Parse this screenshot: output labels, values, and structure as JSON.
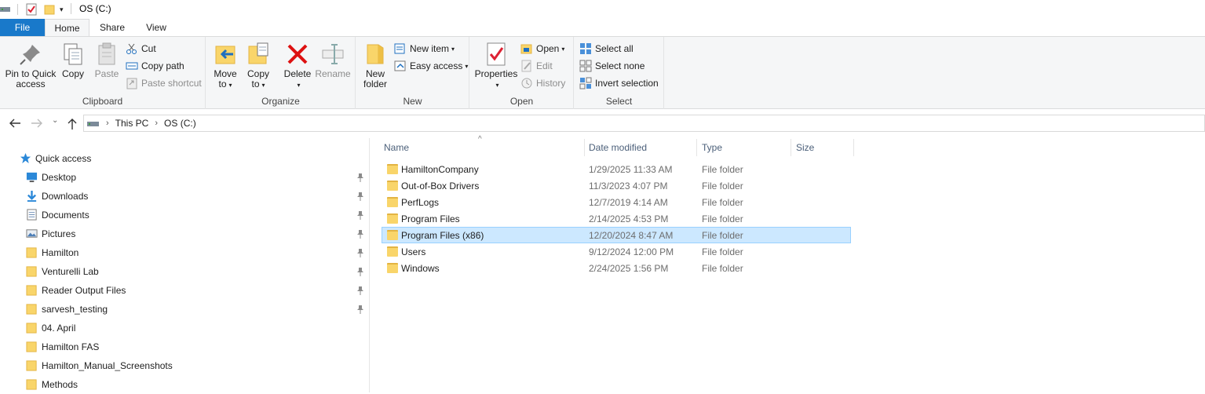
{
  "window": {
    "title": "OS (C:)"
  },
  "tabs": [
    "File",
    "Home",
    "Share",
    "View"
  ],
  "ribbon": {
    "clipboard": {
      "label": "Clipboard",
      "pin_label_1": "Pin to Quick",
      "pin_label_2": "access",
      "copy": "Copy",
      "paste": "Paste",
      "cut": "Cut",
      "copy_path": "Copy path",
      "paste_shortcut": "Paste shortcut"
    },
    "organize": {
      "label": "Organize",
      "move_1": "Move",
      "move_2": "to",
      "copy_1": "Copy",
      "copy_2": "to",
      "delete": "Delete",
      "rename": "Rename"
    },
    "new": {
      "label": "New",
      "new_folder_1": "New",
      "new_folder_2": "folder",
      "new_item": "New item",
      "easy_access": "Easy access"
    },
    "open": {
      "label": "Open",
      "properties": "Properties",
      "open": "Open",
      "edit": "Edit",
      "history": "History"
    },
    "select": {
      "label": "Select",
      "select_all": "Select all",
      "select_none": "Select none",
      "invert": "Invert selection"
    }
  },
  "address": {
    "crumbs": [
      "This PC",
      "OS (C:)"
    ]
  },
  "sidebar": {
    "quick_access": "Quick access",
    "items": [
      {
        "label": "Desktop",
        "icon": "desktop-icon",
        "pinned": true
      },
      {
        "label": "Downloads",
        "icon": "downloads-icon",
        "pinned": true
      },
      {
        "label": "Documents",
        "icon": "documents-icon",
        "pinned": true
      },
      {
        "label": "Pictures",
        "icon": "pictures-icon",
        "pinned": true
      },
      {
        "label": "Hamilton",
        "icon": "folder-icon",
        "pinned": true
      },
      {
        "label": "Venturelli Lab",
        "icon": "folder-icon",
        "pinned": true
      },
      {
        "label": "Reader Output Files",
        "icon": "folder-icon",
        "pinned": true
      },
      {
        "label": "sarvesh_testing",
        "icon": "folder-icon",
        "pinned": true
      },
      {
        "label": "04. April",
        "icon": "folder-icon",
        "pinned": false
      },
      {
        "label": "Hamilton FAS",
        "icon": "folder-icon",
        "pinned": false
      },
      {
        "label": "Hamilton_Manual_Screenshots",
        "icon": "folder-icon",
        "pinned": false
      },
      {
        "label": "Methods",
        "icon": "folder-icon",
        "pinned": false
      }
    ]
  },
  "files": {
    "columns": [
      "Name",
      "Date modified",
      "Type",
      "Size"
    ],
    "rows": [
      {
        "name": "HamiltonCompany",
        "date": "1/29/2025 11:33 AM",
        "type": "File folder",
        "selected": false
      },
      {
        "name": "Out-of-Box Drivers",
        "date": "11/3/2023 4:07 PM",
        "type": "File folder",
        "selected": false
      },
      {
        "name": "PerfLogs",
        "date": "12/7/2019 4:14 AM",
        "type": "File folder",
        "selected": false
      },
      {
        "name": "Program Files",
        "date": "2/14/2025 4:53 PM",
        "type": "File folder",
        "selected": false
      },
      {
        "name": "Program Files (x86)",
        "date": "12/20/2024 8:47 AM",
        "type": "File folder",
        "selected": true
      },
      {
        "name": "Users",
        "date": "9/12/2024 12:00 PM",
        "type": "File folder",
        "selected": false
      },
      {
        "name": "Windows",
        "date": "2/24/2025 1:56 PM",
        "type": "File folder",
        "selected": false
      }
    ]
  }
}
